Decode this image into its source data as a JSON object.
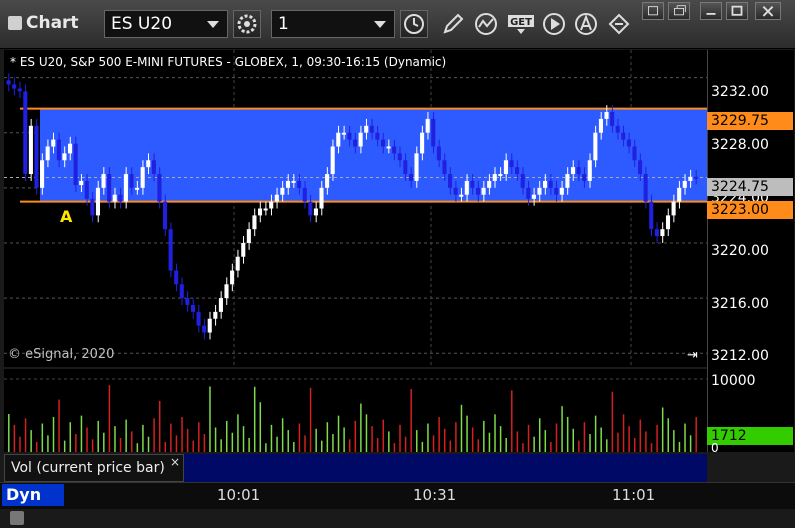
{
  "window": {
    "title": "Chart"
  },
  "toolbar": {
    "symbol": "ES U20",
    "interval": "1"
  },
  "chart": {
    "header": "* ES U20, S&P 500 E-MINI FUTURES - GLOBEX, 1, 09:30-16:15 (Dynamic)",
    "copyright": "© eSignal, 2020",
    "annotation_label": "A",
    "colors": {
      "zone": "#2e5bff",
      "line": "#ff8c1a",
      "up": "#ffffff",
      "down": "#2020e0",
      "vol_up": "#7ddc4a",
      "vol_down": "#d42020"
    }
  },
  "price_axis": {
    "ticks": [
      "3232.00",
      "3228.00",
      "3224.00",
      "3220.00",
      "3216.00",
      "3212.00"
    ],
    "upper_level": "3229.75",
    "lower_level": "3223.00",
    "current_price": "3224.75"
  },
  "volume_axis": {
    "top": "10000",
    "current": "1712",
    "zero": "0"
  },
  "volume_panel": {
    "label": "Vol (current price bar)",
    "close": "×"
  },
  "bottom_bar": {
    "mode": "Dyn",
    "times": [
      "10:01",
      "10:31",
      "11:01"
    ]
  },
  "chart_data": {
    "type": "candlestick",
    "ylim": [
      3211,
      3234
    ],
    "zone": [
      3223.0,
      3229.75
    ],
    "current": 3224.75,
    "closes": [
      3231.5,
      3231.2,
      3231.0,
      3225.0,
      3228.5,
      3224.0,
      3226.0,
      3227.0,
      3227.5,
      3226.0,
      3226.5,
      3227.2,
      3224.2,
      3224.5,
      3223.2,
      3222.0,
      3224.0,
      3225.0,
      3223.0,
      3223.5,
      3223.0,
      3225.0,
      3224.0,
      3224.0,
      3225.5,
      3226.0,
      3225.0,
      3223.0,
      3221.0,
      3218.0,
      3217.0,
      3216.0,
      3215.5,
      3215.0,
      3214.0,
      3213.5,
      3214.5,
      3215.0,
      3216.0,
      3217.0,
      3218.0,
      3219.0,
      3220.0,
      3221.0,
      3222.0,
      3222.5,
      3222.5,
      3223.0,
      3223.5,
      3224.0,
      3224.5,
      3224.5,
      3224.0,
      3223.0,
      3222.0,
      3222.5,
      3224.0,
      3225.0,
      3227.0,
      3228.0,
      3228.0,
      3227.5,
      3227.0,
      3228.0,
      3228.5,
      3228.0,
      3227.5,
      3227.0,
      3227.0,
      3226.5,
      3226.0,
      3225.0,
      3224.5,
      3226.5,
      3228.0,
      3229.0,
      3227.0,
      3226.0,
      3225.0,
      3224.0,
      3223.5,
      3223.5,
      3224.5,
      3224.0,
      3223.5,
      3224.0,
      3224.5,
      3225.0,
      3225.0,
      3226.0,
      3225.5,
      3225.0,
      3224.0,
      3223.2,
      3223.5,
      3224.0,
      3224.5,
      3224.0,
      3223.5,
      3224.0,
      3225.0,
      3225.5,
      3225.0,
      3224.5,
      3226.0,
      3228.0,
      3229.0,
      3229.5,
      3228.5,
      3228.0,
      3227.5,
      3227.0,
      3226.0,
      3225.0,
      3223.0,
      3221.0,
      3220.5,
      3221.0,
      3222.0,
      3223.0,
      3224.0,
      3224.5,
      3224.8,
      3224.75
    ],
    "volume_max": 10000,
    "volume_current": 1712
  }
}
